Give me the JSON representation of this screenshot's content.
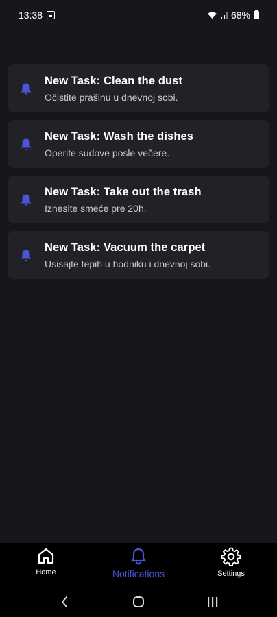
{
  "status_bar": {
    "time": "13:38",
    "battery": "68%"
  },
  "notifications": [
    {
      "title": "New Task: Clean the dust",
      "body": "Očistite prašinu u dnevnoj sobi."
    },
    {
      "title": "New Task: Wash the dishes",
      "body": "Operite sudove posle večere."
    },
    {
      "title": "New Task: Take out the trash",
      "body": "Iznesite smeće pre 20h."
    },
    {
      "title": "New Task: Vacuum the carpet",
      "body": "Usisajte tepih u hodniku i dnevnoj sobi."
    }
  ],
  "bottom_nav": {
    "home_label": "Home",
    "notifications_label": "Notifications",
    "settings_label": "Settings",
    "active": "Notifications"
  },
  "colors": {
    "accent": "#4a55d8",
    "background": "#17161c",
    "card": "#222128"
  }
}
